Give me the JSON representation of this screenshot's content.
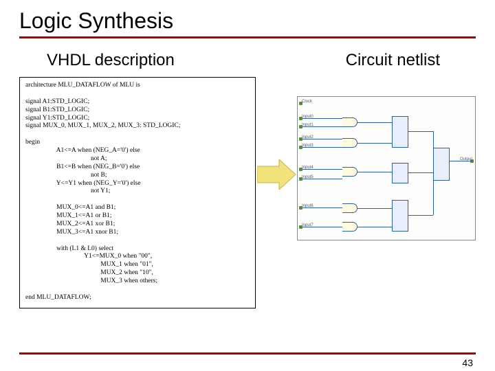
{
  "title": "Logic Synthesis",
  "sub_left": "VHDL description",
  "sub_right": "Circuit netlist",
  "code": {
    "l0": "architecture MLU_DATAFLOW of MLU is",
    "l1": "",
    "l2": "signal A1:STD_LOGIC;",
    "l3": "signal B1:STD_LOGIC;",
    "l4": "signal Y1:STD_LOGIC;",
    "l5": "signal MUX_0, MUX_1, MUX_2, MUX_3: STD_LOGIC;",
    "l6": "",
    "l7": "begin",
    "l8": "                   A1<=A when (NEG_A='0') else",
    "l9": "                                        not A;",
    "l10": "                   B1<=B when (NEG_B='0') else",
    "l11": "                                        not B;",
    "l12": "                   Y<=Y1 when (NEG_Y='0') else",
    "l13": "                                        not Y1;",
    "l14": "",
    "l15": "                   MUX_0<=A1 and B1;",
    "l16": "                   MUX_1<=A1 or B1;",
    "l17": "                   MUX_2<=A1 xor B1;",
    "l18": "                   MUX_3<=A1 xnor B1;",
    "l19": "",
    "l20": "                   with (L1 & L0) select",
    "l21": "                                    Y1<=MUX_0 when \"00\",",
    "l22": "                                              MUX_1 when \"01\",",
    "l23": "                                              MUX_2 when \"10\",",
    "l24": "                                              MUX_3 when others;",
    "l25": "",
    "l26": "end MLU_DATAFLOW;"
  },
  "netlist_labels": {
    "clock": "Clock",
    "in0": "Input0",
    "in1": "Input1",
    "in2": "Input2",
    "in3": "Input3",
    "in4": "Input4",
    "in5": "Input5",
    "in6": "Input6",
    "in7": "Input7",
    "out": "Output"
  },
  "page": "43"
}
